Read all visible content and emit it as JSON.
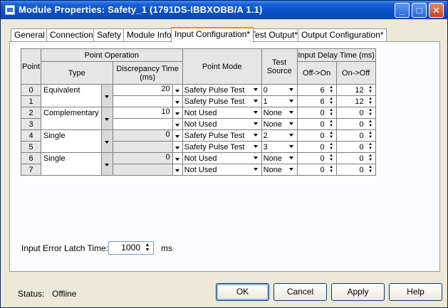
{
  "window": {
    "title": "Module Properties: Safety_1 (1791DS-IBBXOBB/A 1.1)"
  },
  "tabs": [
    {
      "label": "General"
    },
    {
      "label": "Connection"
    },
    {
      "label": "Safety"
    },
    {
      "label": "Module Info"
    },
    {
      "label": "Input Configuration*"
    },
    {
      "label": "Test Output*"
    },
    {
      "label": "Output Configuration*"
    }
  ],
  "active_tab": "Input Configuration*",
  "grid": {
    "headers": {
      "point": "Point",
      "point_operation": "Point Operation",
      "type": "Type",
      "discrepancy": "Discrepancy Time (ms)",
      "point_mode": "Point Mode",
      "test_source": "Test Source",
      "input_delay": "Input Delay Time (ms)",
      "off_on": "Off->On",
      "on_off": "On->Off"
    },
    "pairs": [
      {
        "type": "Equivalent",
        "discrepancy": "20",
        "rows": [
          {
            "point": "0",
            "mode": "Safety Pulse Test",
            "source": "0",
            "off_on": "6",
            "on_off": "12"
          },
          {
            "point": "1",
            "mode": "Safety Pulse Test",
            "source": "1",
            "off_on": "6",
            "on_off": "12"
          }
        ]
      },
      {
        "type": "Complementary",
        "discrepancy": "10",
        "rows": [
          {
            "point": "2",
            "mode": "Not Used",
            "source": "None",
            "off_on": "0",
            "on_off": "0"
          },
          {
            "point": "3",
            "mode": "Not Used",
            "source": "None",
            "off_on": "0",
            "on_off": "0"
          }
        ]
      },
      {
        "type": "Single",
        "discrepancy": "0",
        "rows": [
          {
            "point": "4",
            "mode": "Safety Pulse Test",
            "source": "2",
            "off_on": "0",
            "on_off": "0"
          },
          {
            "point": "5",
            "mode": "Safety Pulse Test",
            "source": "3",
            "off_on": "0",
            "on_off": "0"
          }
        ]
      },
      {
        "type": "Single",
        "discrepancy": "0",
        "rows": [
          {
            "point": "6",
            "mode": "Not Used",
            "source": "None",
            "off_on": "0",
            "on_off": "0"
          },
          {
            "point": "7",
            "mode": "Not Used",
            "source": "None",
            "off_on": "0",
            "on_off": "0"
          }
        ]
      }
    ]
  },
  "latch": {
    "label": "Input Error Latch Time:",
    "value": "1000",
    "unit": "ms"
  },
  "status": {
    "label": "Status:",
    "value": "Offline"
  },
  "buttons": {
    "ok": "OK",
    "cancel": "Cancel",
    "apply": "Apply",
    "help": "Help"
  },
  "colors": {
    "title_bar": "#0a50c8",
    "active_tab_accent": "#e68b2c",
    "dialog_bg": "#ece9d8"
  }
}
